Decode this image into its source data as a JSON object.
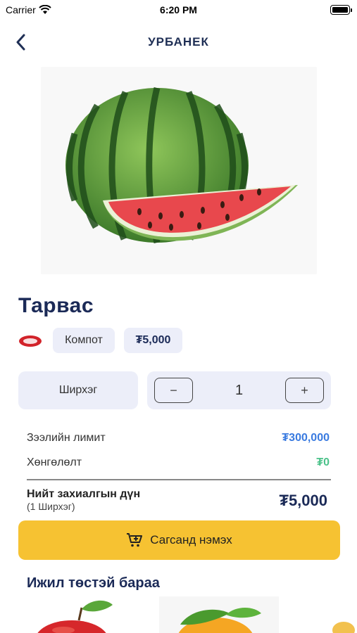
{
  "status_bar": {
    "carrier": "Carrier",
    "time": "6:20 PM"
  },
  "nav": {
    "title": "УРБАНЕК",
    "back_icon": "chevron-left-icon"
  },
  "product": {
    "image": "watermelon",
    "title": "Тарвас",
    "brand_logo": "brand-logo",
    "category": "Компот",
    "price": "₮5,000"
  },
  "order": {
    "unit": "Ширхэг",
    "minus_label": "−",
    "plus_label": "+",
    "quantity": "1"
  },
  "summary": {
    "limit_label": "Зээлийн лимит",
    "limit_value": "₮300,000",
    "discount_label": "Хөнгөлөлт",
    "discount_value": "₮0",
    "total_label": "Нийт захиалгын дүн",
    "total_sub": "(1  Ширхэг)",
    "total_value": "₮5,000"
  },
  "actions": {
    "add_to_cart": "Сагсанд нэмэх",
    "cart_icon": "cart-plus-icon"
  },
  "similar": {
    "title": "Ижил төстэй бараа",
    "items": [
      "apple",
      "orange",
      "fruit"
    ]
  },
  "colors": {
    "accent": "#f6c232",
    "title": "#1b2a57",
    "chip_bg": "#eceef9",
    "limit": "#3a7be0",
    "discount": "#4cc28a"
  }
}
